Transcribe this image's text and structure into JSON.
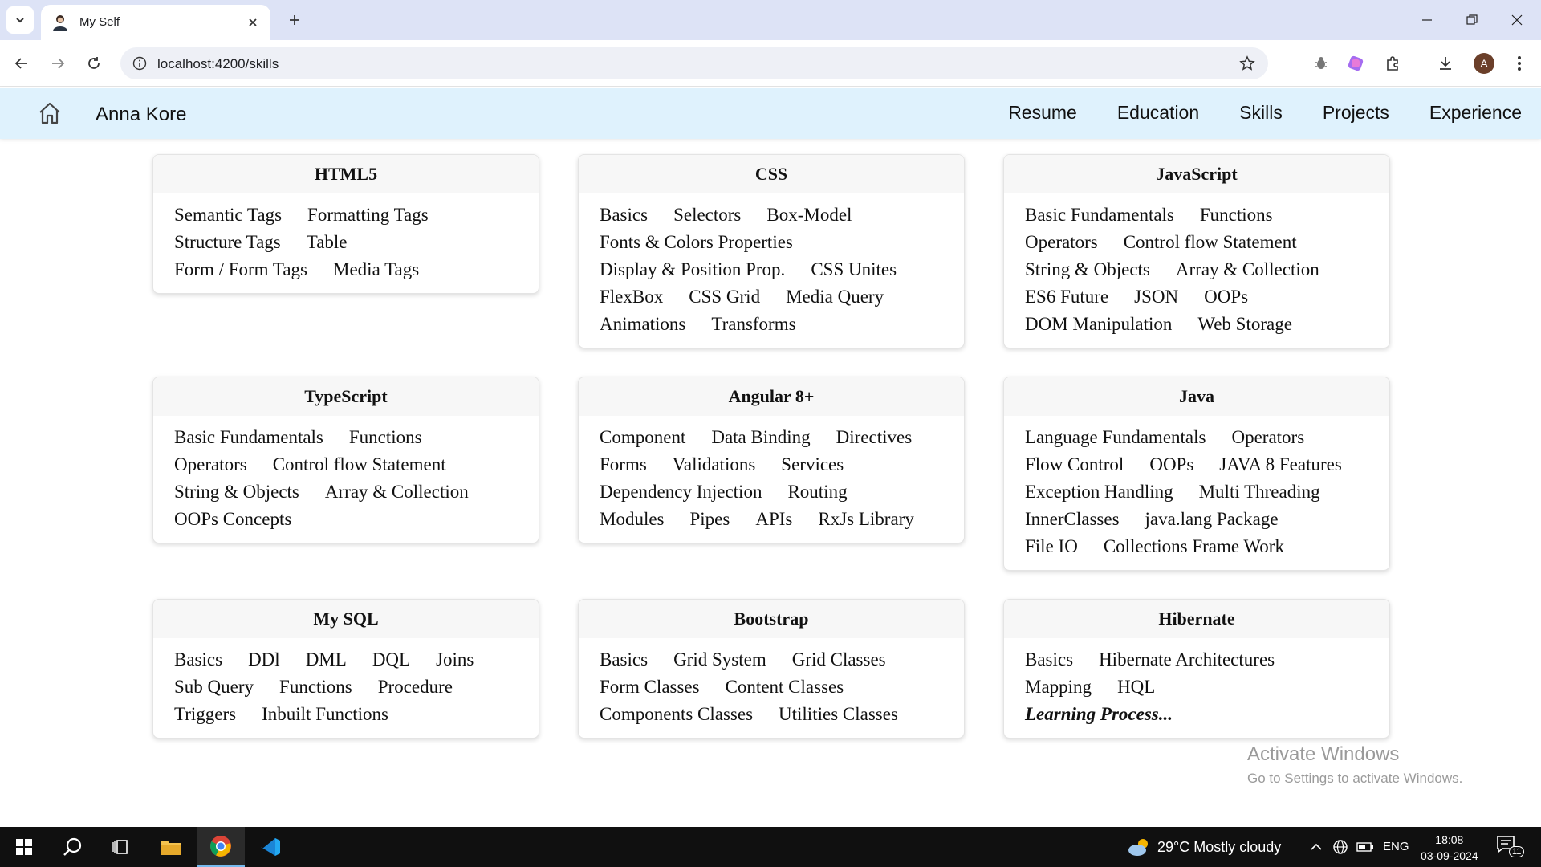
{
  "browser": {
    "tab_title": "My Self",
    "url": "localhost:4200/skills",
    "avatar_letter": "A"
  },
  "navbar": {
    "brand": "Anna Kore",
    "links": [
      "Resume",
      "Education",
      "Skills",
      "Projects",
      "Experience"
    ]
  },
  "cards": [
    {
      "title": "HTML5",
      "rows": [
        [
          "Semantic Tags",
          "Formatting Tags"
        ],
        [
          "Structure Tags",
          "Table"
        ],
        [
          "Form / Form Tags",
          "Media Tags"
        ]
      ]
    },
    {
      "title": "CSS",
      "rows": [
        [
          "Basics",
          "Selectors",
          "Box-Model"
        ],
        [
          "Fonts & Colors Properties"
        ],
        [
          "Display & Position Prop.",
          "CSS Unites"
        ],
        [
          "FlexBox",
          "CSS Grid",
          "Media Query"
        ],
        [
          "Animations",
          "Transforms"
        ]
      ]
    },
    {
      "title": "JavaScript",
      "rows": [
        [
          "Basic Fundamentals",
          "Functions"
        ],
        [
          "Operators",
          "Control flow Statement"
        ],
        [
          "String & Objects",
          "Array & Collection"
        ],
        [
          "ES6 Future",
          "JSON",
          "OOPs"
        ],
        [
          "DOM Manipulation",
          "Web Storage"
        ]
      ]
    },
    {
      "title": "TypeScript",
      "rows": [
        [
          "Basic Fundamentals",
          "Functions"
        ],
        [
          "Operators",
          "Control flow Statement"
        ],
        [
          "String & Objects",
          "Array & Collection"
        ],
        [
          "OOPs Concepts"
        ]
      ]
    },
    {
      "title": "Angular 8+",
      "rows": [
        [
          "Component",
          "Data Binding",
          "Directives"
        ],
        [
          "Forms",
          "Validations",
          "Services"
        ],
        [
          "Dependency Injection",
          "Routing"
        ],
        [
          "Modules",
          "Pipes",
          "APIs",
          "RxJs Library"
        ]
      ]
    },
    {
      "title": "Java",
      "rows": [
        [
          "Language Fundamentals",
          "Operators"
        ],
        [
          "Flow Control",
          "OOPs",
          "JAVA 8 Features"
        ],
        [
          "Exception Handling",
          "Multi Threading"
        ],
        [
          "InnerClasses",
          "java.lang Package"
        ],
        [
          "File IO",
          "Collections Frame Work"
        ]
      ]
    },
    {
      "title": "My SQL",
      "rows": [
        [
          "Basics",
          "DDl",
          "DML",
          "DQL",
          "Joins"
        ],
        [
          "Sub Query",
          "Functions",
          "Procedure"
        ],
        [
          "Triggers",
          "Inbuilt Functions"
        ]
      ]
    },
    {
      "title": "Bootstrap",
      "rows": [
        [
          "Basics",
          "Grid System",
          "Grid Classes"
        ],
        [
          "Form Classes",
          "Content Classes"
        ],
        [
          "Components Classes",
          "Utilities Classes"
        ]
      ]
    },
    {
      "title": "Hibernate",
      "rows": [
        [
          "Basics",
          "Hibernate Architectures"
        ],
        [
          "Mapping",
          "HQL"
        ]
      ],
      "emphasis": "Learning Process..."
    }
  ],
  "watermark": {
    "title": "Activate Windows",
    "subtitle": "Go to Settings to activate Windows."
  },
  "taskbar": {
    "weather": "29°C  Mostly cloudy",
    "language": "ENG",
    "time": "18:08",
    "date": "03-09-2024",
    "notification_count": "11"
  }
}
